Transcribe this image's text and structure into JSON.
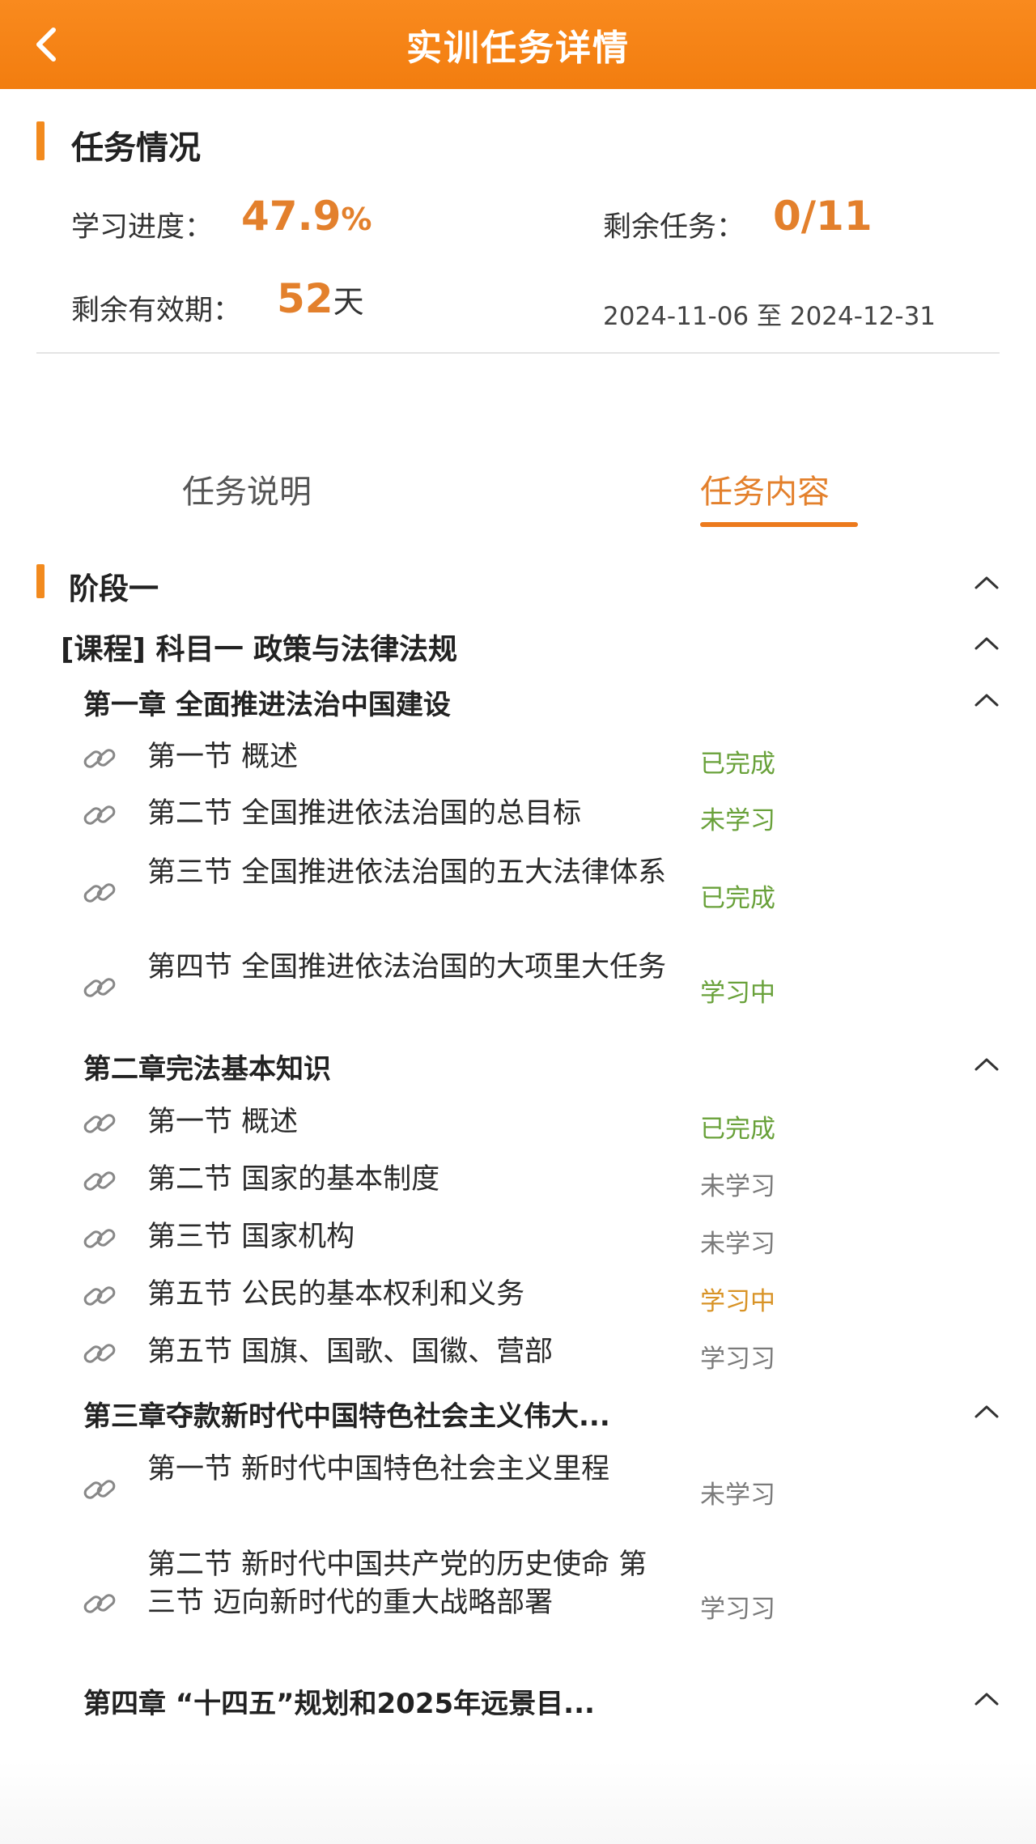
{
  "header": {
    "title": "实训任务详情"
  },
  "summary": {
    "section_title": "任务情况",
    "progress_label": "学习进度：",
    "progress_value": "47.9",
    "progress_unit": "%",
    "remaining_tasks_label": "剩余任务：",
    "remaining_tasks_value": "0/11",
    "validity_label": "剩余有效期：",
    "validity_value": "52",
    "validity_unit": "天",
    "date_range": "2024-11-06 至 2024-12-31"
  },
  "tabs": [
    {
      "label": "任务说明",
      "active": false
    },
    {
      "label": "任务内容",
      "active": true
    }
  ],
  "stage": {
    "title": "阶段一"
  },
  "course": {
    "title": "[课程] 科目一 政策与法律法规"
  },
  "chapters": [
    {
      "title": "第一章 全面推进法治中国建设",
      "sections": [
        {
          "title": "第一节 概述",
          "status": "已完成"
        },
        {
          "title": "第二节 全国推进依法治国的总目标",
          "status": "未学习"
        },
        {
          "title": "第三节 全国推进依法治国的五大法律体系",
          "status": "已完成"
        },
        {
          "title": "第四节 全国推进依法治国的大项里大任务",
          "status": "学习中"
        }
      ]
    },
    {
      "title": "第二章完法基本知识",
      "sections": [
        {
          "title": "第一节 概述",
          "status": "已完成"
        },
        {
          "title": "第二节 国家的基本制度",
          "status": "未学习"
        },
        {
          "title": "第三节 国家机构",
          "status": "未学习"
        },
        {
          "title": "第五节 公民的基本权利和义务",
          "status": "学习中"
        },
        {
          "title": "第五节 国旗、国歌、国徽、营部",
          "status": "学习习"
        }
      ]
    },
    {
      "title": "第三章夺款新时代中国特色社会主义伟大...",
      "sections": [
        {
          "title": "第一节 新时代中国特色社会主义里程",
          "status": "未学习"
        },
        {
          "title": "第二节 新时代中国共产党的历史使命 第三节 迈向新时代的重大战略部署",
          "status": "学习习"
        }
      ]
    },
    {
      "title": "第四章 “十四五”规划和2025年远景目...",
      "sections": []
    }
  ],
  "icons": {
    "back": "chevron-left-icon",
    "collapse": "chevron-up-icon",
    "section": "link-icon"
  },
  "colors": {
    "header_orange": "#f5821a",
    "accent_orange": "#e3802c",
    "status_green": "#69a13a",
    "status_gray": "#7a7a7a",
    "status_amber": "#d89326"
  }
}
